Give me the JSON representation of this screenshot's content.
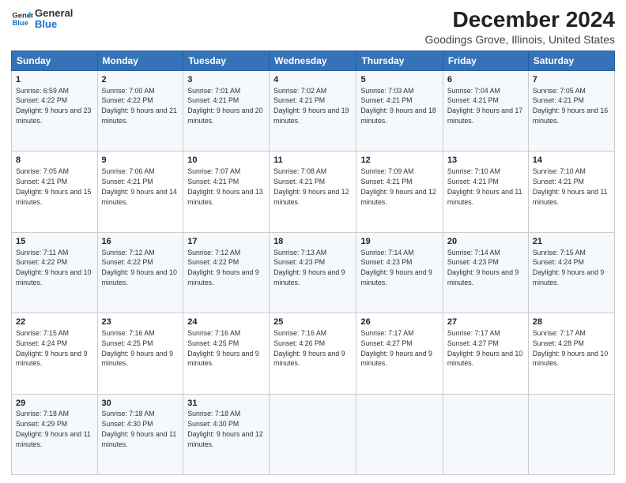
{
  "header": {
    "logo_line1": "General",
    "logo_line2": "Blue",
    "title": "December 2024",
    "subtitle": "Goodings Grove, Illinois, United States"
  },
  "days_of_week": [
    "Sunday",
    "Monday",
    "Tuesday",
    "Wednesday",
    "Thursday",
    "Friday",
    "Saturday"
  ],
  "weeks": [
    [
      {
        "day": "1",
        "sunrise": "Sunrise: 6:59 AM",
        "sunset": "Sunset: 4:22 PM",
        "daylight": "Daylight: 9 hours and 23 minutes."
      },
      {
        "day": "2",
        "sunrise": "Sunrise: 7:00 AM",
        "sunset": "Sunset: 4:22 PM",
        "daylight": "Daylight: 9 hours and 21 minutes."
      },
      {
        "day": "3",
        "sunrise": "Sunrise: 7:01 AM",
        "sunset": "Sunset: 4:21 PM",
        "daylight": "Daylight: 9 hours and 20 minutes."
      },
      {
        "day": "4",
        "sunrise": "Sunrise: 7:02 AM",
        "sunset": "Sunset: 4:21 PM",
        "daylight": "Daylight: 9 hours and 19 minutes."
      },
      {
        "day": "5",
        "sunrise": "Sunrise: 7:03 AM",
        "sunset": "Sunset: 4:21 PM",
        "daylight": "Daylight: 9 hours and 18 minutes."
      },
      {
        "day": "6",
        "sunrise": "Sunrise: 7:04 AM",
        "sunset": "Sunset: 4:21 PM",
        "daylight": "Daylight: 9 hours and 17 minutes."
      },
      {
        "day": "7",
        "sunrise": "Sunrise: 7:05 AM",
        "sunset": "Sunset: 4:21 PM",
        "daylight": "Daylight: 9 hours and 16 minutes."
      }
    ],
    [
      {
        "day": "8",
        "sunrise": "Sunrise: 7:05 AM",
        "sunset": "Sunset: 4:21 PM",
        "daylight": "Daylight: 9 hours and 15 minutes."
      },
      {
        "day": "9",
        "sunrise": "Sunrise: 7:06 AM",
        "sunset": "Sunset: 4:21 PM",
        "daylight": "Daylight: 9 hours and 14 minutes."
      },
      {
        "day": "10",
        "sunrise": "Sunrise: 7:07 AM",
        "sunset": "Sunset: 4:21 PM",
        "daylight": "Daylight: 9 hours and 13 minutes."
      },
      {
        "day": "11",
        "sunrise": "Sunrise: 7:08 AM",
        "sunset": "Sunset: 4:21 PM",
        "daylight": "Daylight: 9 hours and 12 minutes."
      },
      {
        "day": "12",
        "sunrise": "Sunrise: 7:09 AM",
        "sunset": "Sunset: 4:21 PM",
        "daylight": "Daylight: 9 hours and 12 minutes."
      },
      {
        "day": "13",
        "sunrise": "Sunrise: 7:10 AM",
        "sunset": "Sunset: 4:21 PM",
        "daylight": "Daylight: 9 hours and 11 minutes."
      },
      {
        "day": "14",
        "sunrise": "Sunrise: 7:10 AM",
        "sunset": "Sunset: 4:21 PM",
        "daylight": "Daylight: 9 hours and 11 minutes."
      }
    ],
    [
      {
        "day": "15",
        "sunrise": "Sunrise: 7:11 AM",
        "sunset": "Sunset: 4:22 PM",
        "daylight": "Daylight: 9 hours and 10 minutes."
      },
      {
        "day": "16",
        "sunrise": "Sunrise: 7:12 AM",
        "sunset": "Sunset: 4:22 PM",
        "daylight": "Daylight: 9 hours and 10 minutes."
      },
      {
        "day": "17",
        "sunrise": "Sunrise: 7:12 AM",
        "sunset": "Sunset: 4:22 PM",
        "daylight": "Daylight: 9 hours and 9 minutes."
      },
      {
        "day": "18",
        "sunrise": "Sunrise: 7:13 AM",
        "sunset": "Sunset: 4:23 PM",
        "daylight": "Daylight: 9 hours and 9 minutes."
      },
      {
        "day": "19",
        "sunrise": "Sunrise: 7:14 AM",
        "sunset": "Sunset: 4:23 PM",
        "daylight": "Daylight: 9 hours and 9 minutes."
      },
      {
        "day": "20",
        "sunrise": "Sunrise: 7:14 AM",
        "sunset": "Sunset: 4:23 PM",
        "daylight": "Daylight: 9 hours and 9 minutes."
      },
      {
        "day": "21",
        "sunrise": "Sunrise: 7:15 AM",
        "sunset": "Sunset: 4:24 PM",
        "daylight": "Daylight: 9 hours and 9 minutes."
      }
    ],
    [
      {
        "day": "22",
        "sunrise": "Sunrise: 7:15 AM",
        "sunset": "Sunset: 4:24 PM",
        "daylight": "Daylight: 9 hours and 9 minutes."
      },
      {
        "day": "23",
        "sunrise": "Sunrise: 7:16 AM",
        "sunset": "Sunset: 4:25 PM",
        "daylight": "Daylight: 9 hours and 9 minutes."
      },
      {
        "day": "24",
        "sunrise": "Sunrise: 7:16 AM",
        "sunset": "Sunset: 4:25 PM",
        "daylight": "Daylight: 9 hours and 9 minutes."
      },
      {
        "day": "25",
        "sunrise": "Sunrise: 7:16 AM",
        "sunset": "Sunset: 4:26 PM",
        "daylight": "Daylight: 9 hours and 9 minutes."
      },
      {
        "day": "26",
        "sunrise": "Sunrise: 7:17 AM",
        "sunset": "Sunset: 4:27 PM",
        "daylight": "Daylight: 9 hours and 9 minutes."
      },
      {
        "day": "27",
        "sunrise": "Sunrise: 7:17 AM",
        "sunset": "Sunset: 4:27 PM",
        "daylight": "Daylight: 9 hours and 10 minutes."
      },
      {
        "day": "28",
        "sunrise": "Sunrise: 7:17 AM",
        "sunset": "Sunset: 4:28 PM",
        "daylight": "Daylight: 9 hours and 10 minutes."
      }
    ],
    [
      {
        "day": "29",
        "sunrise": "Sunrise: 7:18 AM",
        "sunset": "Sunset: 4:29 PM",
        "daylight": "Daylight: 9 hours and 11 minutes."
      },
      {
        "day": "30",
        "sunrise": "Sunrise: 7:18 AM",
        "sunset": "Sunset: 4:30 PM",
        "daylight": "Daylight: 9 hours and 11 minutes."
      },
      {
        "day": "31",
        "sunrise": "Sunrise: 7:18 AM",
        "sunset": "Sunset: 4:30 PM",
        "daylight": "Daylight: 9 hours and 12 minutes."
      },
      null,
      null,
      null,
      null
    ]
  ]
}
